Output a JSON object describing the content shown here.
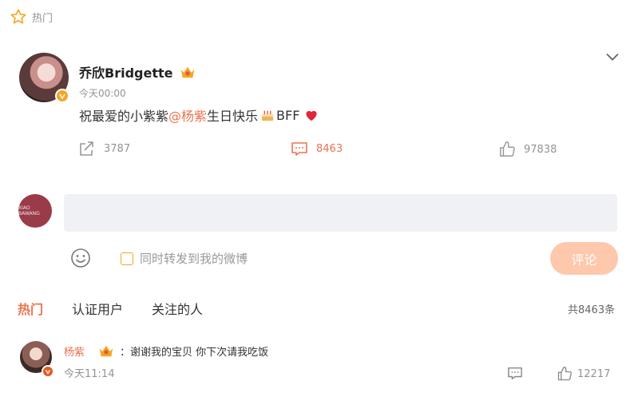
{
  "section": {
    "label": "热门"
  },
  "post": {
    "author": "乔欣Bridgette",
    "time": "今天00:00",
    "text_before": "祝最爱的小紫紫",
    "mention": "@杨紫",
    "text_after": " 生日快乐",
    "text_tail": "BFF",
    "repost_count": "3787",
    "comment_count": "8463",
    "like_count": "97838"
  },
  "composer": {
    "input_value": "",
    "avatar_text": "XIAO BAWANG",
    "repost_label": "同时转发到我的微博",
    "submit_label": "评论"
  },
  "tabs": [
    "热门",
    "认证用户",
    "关注的人"
  ],
  "total_label": "共8463条",
  "comments": [
    {
      "name": "杨紫",
      "separator": "：",
      "text": "谢谢我的宝贝 你下次请我吃饭",
      "time": "今天11:14",
      "like_count": "12217"
    }
  ],
  "colors": {
    "accent": "#eb7350",
    "submit_bg": "#fdc8ac",
    "input_bg": "#f0f1f4",
    "muted": "#939393"
  }
}
